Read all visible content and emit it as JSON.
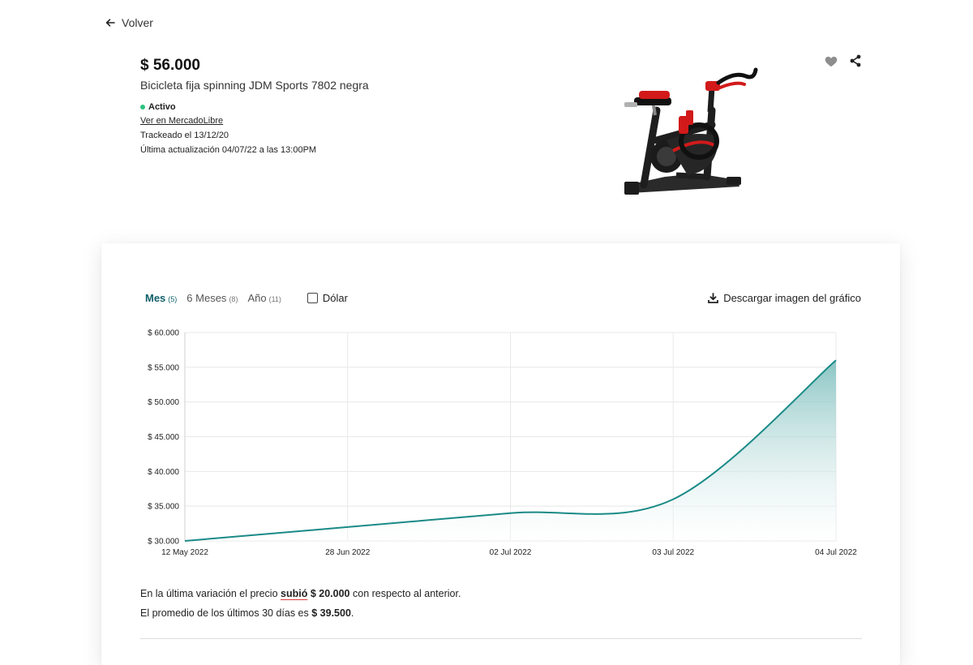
{
  "nav": {
    "back_label": "Volver"
  },
  "product": {
    "price": "$ 56.000",
    "title": "Bicicleta fija spinning JDM Sports 7802 negra",
    "status": "Activo",
    "ml_link": "Ver en MercadoLibre",
    "tracked": "Trackeado el 13/12/20",
    "updated": "Última actualización 04/07/22 a las 13:00PM"
  },
  "chart_controls": {
    "tabs": [
      {
        "label": "Mes",
        "count": "(5)",
        "active": true
      },
      {
        "label": "6 Meses",
        "count": "(8)",
        "active": false
      },
      {
        "label": "Año",
        "count": "(11)",
        "active": false
      }
    ],
    "dolar_label": "Dólar",
    "download_label": "Descargar imagen del gráfico"
  },
  "colors": {
    "line": "#1a8a87",
    "fill_top": "#7dbfbd",
    "active_tab": "#0f5f68",
    "status": "#2ec27e",
    "underline": "#e03a3a"
  },
  "chart_data": {
    "type": "area",
    "x": [
      "12 May 2022",
      "28 Jun 2022",
      "02 Jul 2022",
      "03 Jul 2022",
      "04 Jul 2022"
    ],
    "y_tick_labels": [
      "$ 60.000",
      "$ 55.000",
      "$ 50.000",
      "$ 45.000",
      "$ 40.000",
      "$ 35.000",
      "$ 30.000"
    ],
    "y_ticks": [
      60000,
      55000,
      50000,
      45000,
      40000,
      35000,
      30000
    ],
    "ylim": [
      30000,
      60000
    ],
    "series": [
      {
        "values": [
          30000,
          32000,
          34000,
          36000,
          56000
        ]
      }
    ],
    "grid": true
  },
  "summary": {
    "line1_prefix": "En la última variación el precio",
    "direction": "subió",
    "change_amount": "$ 20.000",
    "line1_suffix": "con respecto al anterior.",
    "line2_prefix": "El promedio de los últimos 30 días es",
    "average": "$ 39.500",
    "line2_suffix": "."
  }
}
